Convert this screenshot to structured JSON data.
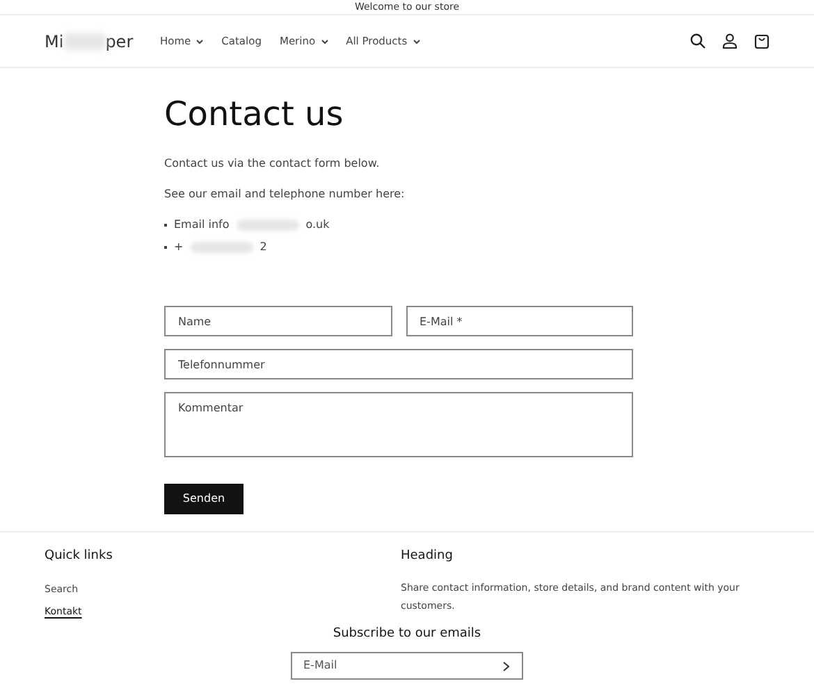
{
  "announcement": "Welcome to our store",
  "header": {
    "logo_start": "Mi",
    "logo_end": "per",
    "nav": [
      {
        "label": "Home",
        "dropdown": true
      },
      {
        "label": "Catalog",
        "dropdown": false
      },
      {
        "label": "Merino",
        "dropdown": true
      },
      {
        "label": "All Products",
        "dropdown": true
      }
    ]
  },
  "page": {
    "title": "Contact us",
    "paragraphs": [
      "Contact us via the contact form below.",
      "See our email and telephone number here:"
    ],
    "contacts": [
      {
        "start": "Email info",
        "end": "o.uk"
      },
      {
        "start": "+",
        "end": "2"
      }
    ]
  },
  "form": {
    "fields": [
      {
        "placeholder": "Name",
        "kind": "half"
      },
      {
        "placeholder": "E-Mail *",
        "kind": "half"
      },
      {
        "placeholder": "Telefonnummer",
        "kind": "full"
      },
      {
        "placeholder": "Kommentar",
        "kind": "area"
      }
    ],
    "submit": "Senden"
  },
  "footer": {
    "quick_links": {
      "heading": "Quick links",
      "links": [
        {
          "label": "Search",
          "selected": false
        },
        {
          "label": "Kontakt",
          "selected": true
        }
      ]
    },
    "info": {
      "heading": "Heading",
      "text": "Share contact information, store details, and brand content with your customers."
    },
    "newsletter": {
      "heading": "Subscribe to our emails",
      "placeholder": "E-Mail"
    }
  }
}
